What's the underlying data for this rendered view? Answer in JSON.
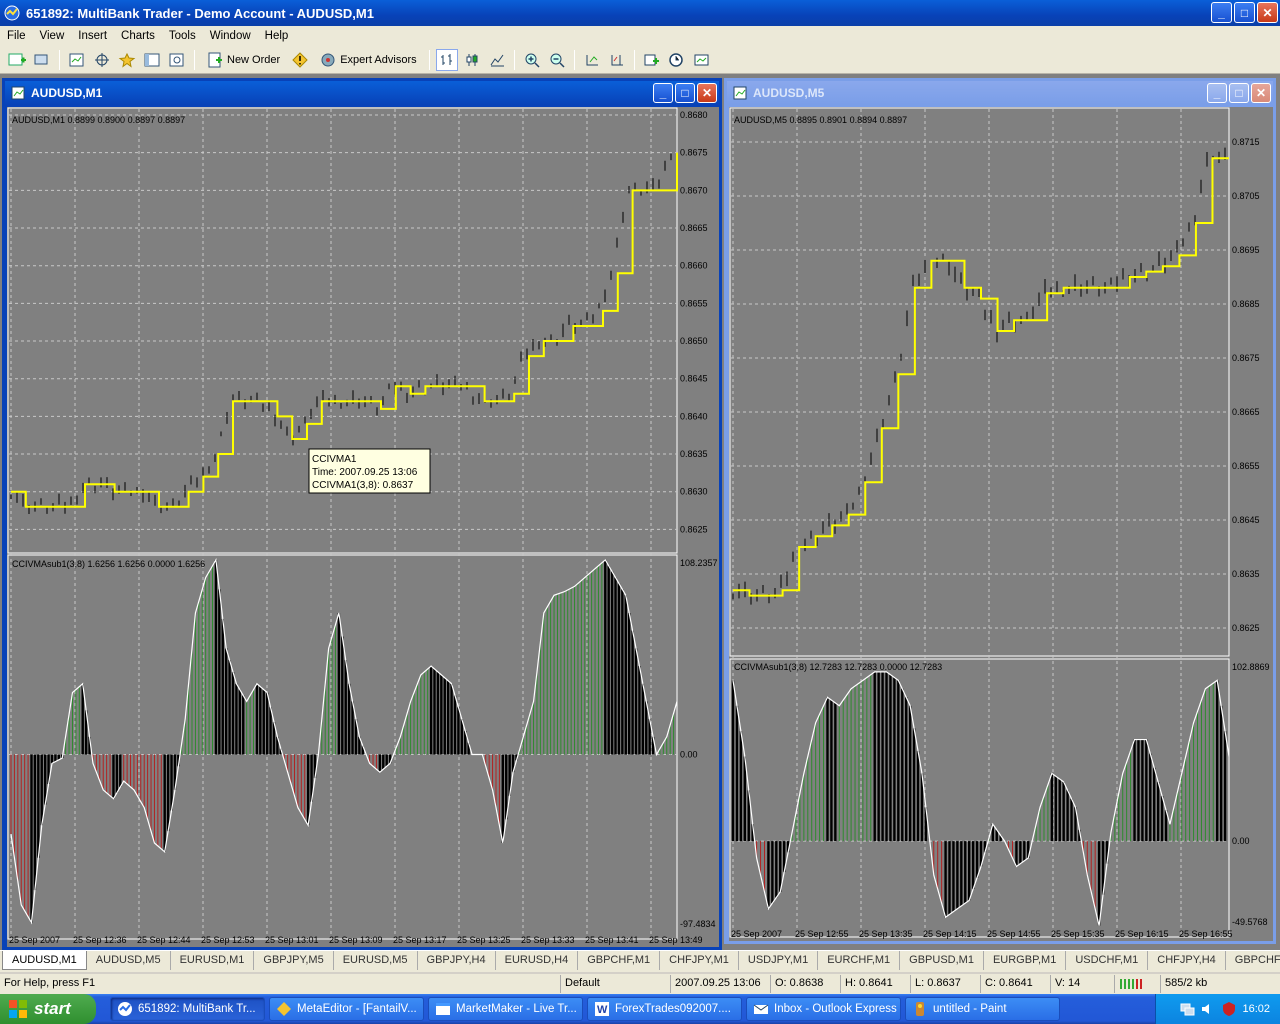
{
  "app": {
    "title": "651892: MultiBank Trader - Demo Account - AUDUSD,M1",
    "window_buttons": [
      "_",
      "□",
      "✕"
    ]
  },
  "menu": [
    "File",
    "View",
    "Insert",
    "Charts",
    "Tools",
    "Window",
    "Help"
  ],
  "toolbar": {
    "new_order": "New Order",
    "expert_advisors": "Expert Advisors"
  },
  "chart_windows": [
    {
      "title": "AUDUSD,M1",
      "price_header": "AUDUSD,M1  0.8899 0.8900 0.8897 0.8897",
      "price_ticks": [
        "0.8680",
        "0.8675",
        "0.8670",
        "0.8665",
        "0.8660",
        "0.8655",
        "0.8650",
        "0.8645",
        "0.8640",
        "0.8635",
        "0.8630",
        "0.8625"
      ],
      "ind_header": "CCIVMAsub1(3,8) 1.6256 1.6256 0.0000 1.6256",
      "ind_ticks": [
        "108.2357",
        "0.00",
        "-97.4834"
      ],
      "time_labels": [
        "25 Sep 2007",
        "25 Sep 12:36",
        "25 Sep 12:44",
        "25 Sep 12:53",
        "25 Sep 13:01",
        "25 Sep 13:09",
        "25 Sep 13:17",
        "25 Sep 13:25",
        "25 Sep 13:33",
        "25 Sep 13:41",
        "25 Sep 13:49"
      ],
      "tooltip": [
        "CCIVMA1",
        "Time: 2007.09.25 13:06",
        "CCIVMA1(3,8): 0.8637"
      ]
    },
    {
      "title": "AUDUSD,M5",
      "price_header": "AUDUSD,M5  0.8895 0.8901 0.8894 0.8897",
      "price_ticks": [
        "0.8715",
        "0.8705",
        "0.8695",
        "0.8685",
        "0.8675",
        "0.8665",
        "0.8655",
        "0.8645",
        "0.8635",
        "0.8625"
      ],
      "ind_header": "CCIVMAsub1(3,8) 12.7283 12.7283 0.0000 12.7283",
      "ind_ticks": [
        "102.8869",
        "0.00",
        "-49.5768"
      ],
      "time_labels": [
        "25 Sep 2007",
        "25 Sep 12:55",
        "25 Sep 13:35",
        "25 Sep 14:15",
        "25 Sep 14:55",
        "25 Sep 15:35",
        "25 Sep 16:15",
        "25 Sep 16:55"
      ]
    }
  ],
  "tabs": [
    "AUDUSD,M1",
    "AUDUSD,M5",
    "EURUSD,M1",
    "GBPJPY,M5",
    "EURUSD,M5",
    "GBPJPY,H4",
    "EURUSD,H4",
    "GBPCHF,M1",
    "CHFJPY,M1",
    "USDJPY,M1",
    "EURCHF,M1",
    "GBPUSD,M1",
    "EURGBP,M1",
    "USDCHF,M1",
    "CHFJPY,H4",
    "GBPCHF,H"
  ],
  "active_tab": "AUDUSD,M1",
  "status": {
    "help": "For Help, press F1",
    "profile": "Default",
    "time": "2007.09.25 13:06",
    "open": "O: 0.8638",
    "high": "H: 0.8641",
    "low": "L: 0.8637",
    "close": "C: 0.8641",
    "volume": "V: 14",
    "traffic": "585/2 kb"
  },
  "taskbar": {
    "start": "start",
    "tasks": [
      "651892: MultiBank Tr...",
      "MetaEditor - [FantailV...",
      "MarketMaker - Live Tr...",
      "ForexTrades092007....",
      "Inbox - Outlook Express",
      "untitled - Paint"
    ],
    "clock": "16:02"
  },
  "colors": {
    "chart_bg": "#808080",
    "ma_line": "#ffff00",
    "hist_green": "#2e8b2e",
    "hist_red": "#b22222",
    "hist_black": "#000000",
    "grid": "#c8c8c8"
  },
  "chart_data": [
    {
      "type": "line",
      "title": "AUDUSD,M1",
      "series": [
        {
          "name": "CCIVMA1",
          "values": [
            0.863,
            0.8628,
            0.8628,
            0.8628,
            0.8628,
            0.8631,
            0.8631,
            0.863,
            0.863,
            0.863,
            0.8628,
            0.8628,
            0.863,
            0.8632,
            0.8635,
            0.8642,
            0.8642,
            0.8642,
            0.864,
            0.8637,
            0.8639,
            0.8642,
            0.8642,
            0.8642,
            0.8642,
            0.8641,
            0.8644,
            0.8643,
            0.8644,
            0.8644,
            0.8644,
            0.8644,
            0.8642,
            0.8642,
            0.8643,
            0.8648,
            0.865,
            0.865,
            0.8652,
            0.8652,
            0.8654,
            0.8659,
            0.867,
            0.867,
            0.867,
            0.8675
          ]
        }
      ],
      "ylim": [
        0.8622,
        0.868
      ]
    },
    {
      "type": "bar",
      "title": "CCIVMAsub1(3,8)",
      "values": [
        -45,
        -85,
        -95,
        -40,
        -5,
        -2,
        35,
        40,
        -5,
        -20,
        -25,
        -15,
        -20,
        -30,
        -50,
        -55,
        -20,
        20,
        80,
        100,
        110,
        60,
        40,
        30,
        40,
        35,
        10,
        -10,
        -30,
        -40,
        0,
        60,
        80,
        40,
        10,
        -5,
        -10,
        -5,
        10,
        30,
        45,
        50,
        45,
        40,
        20,
        0,
        0,
        -20,
        -50,
        -10,
        10,
        30,
        80,
        90,
        92,
        95,
        100,
        105,
        110,
        100,
        90,
        60,
        30,
        0,
        10,
        30
      ],
      "ylim": [
        -97.4834,
        108.2357
      ]
    },
    {
      "type": "line",
      "title": "AUDUSD,M5",
      "series": [
        {
          "name": "CCIVMA1",
          "values": [
            0.8632,
            0.8631,
            0.8631,
            0.8632,
            0.864,
            0.8642,
            0.8644,
            0.8646,
            0.8652,
            0.8662,
            0.8672,
            0.8688,
            0.8693,
            0.8693,
            0.8688,
            0.8686,
            0.868,
            0.8682,
            0.8682,
            0.8687,
            0.8688,
            0.8688,
            0.8688,
            0.8688,
            0.869,
            0.8691,
            0.8692,
            0.8694,
            0.87,
            0.8712,
            0.8712
          ]
        }
      ],
      "ylim": [
        0.862,
        0.872
      ]
    },
    {
      "type": "bar",
      "title": "CCIVMAsub1(3,8)",
      "values": [
        95,
        50,
        -10,
        -40,
        -30,
        5,
        40,
        70,
        85,
        80,
        90,
        95,
        100,
        100,
        95,
        80,
        40,
        -20,
        -45,
        -40,
        -35,
        -15,
        10,
        0,
        -15,
        -10,
        20,
        40,
        35,
        20,
        -20,
        -50,
        5,
        40,
        60,
        60,
        35,
        10,
        40,
        70,
        90,
        95,
        50
      ],
      "ylim": [
        -49.5768,
        102.8869
      ]
    }
  ]
}
